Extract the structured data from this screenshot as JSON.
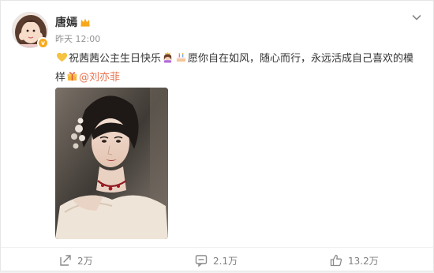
{
  "user": {
    "name": "唐嫣",
    "time": "昨天 12:00",
    "verified_mark": "v"
  },
  "post": {
    "text_part1": "祝茜茜公主生日快乐",
    "text_part2": "愿你自在如风，随心而行，永远活成自己喜欢的模样",
    "mention": "@刘亦菲"
  },
  "actions": {
    "forward": "2万",
    "comment": "2.1万",
    "like": "13.2万"
  },
  "icons": {
    "crown": "crown-icon",
    "more": "chevron-down-icon",
    "heart": "yellow-heart-emoji",
    "princess": "princess-emoji",
    "cake": "birthday-cake-emoji",
    "gift": "gift-emoji",
    "forward": "forward-icon",
    "comment": "comment-icon",
    "like": "thumbs-up-icon"
  },
  "colors": {
    "mention": "#eb7350",
    "verified": "#f7a91b",
    "crown": "#f7a91b",
    "muted_text": "#939393",
    "action_text": "#808080"
  }
}
